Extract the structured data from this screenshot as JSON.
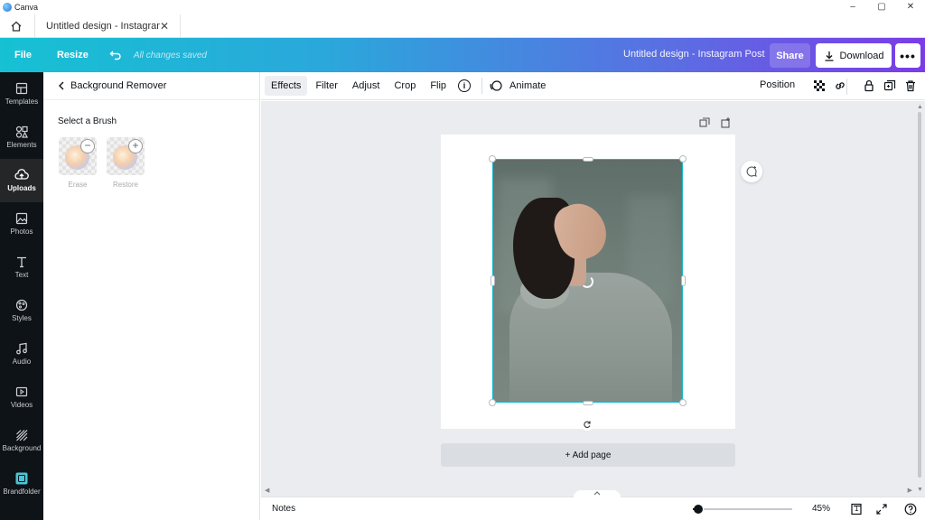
{
  "window": {
    "app_name": "Canva",
    "controls": [
      "–",
      "▢",
      "✕"
    ]
  },
  "tab": {
    "title": "Untitled design - Instagram P",
    "close": "✕"
  },
  "header": {
    "file_label": "File",
    "resize_label": "Resize",
    "saved_status": "All changes saved",
    "design_title": "Untitled design - Instagram Post",
    "share_label": "Share",
    "download_label": "Download",
    "more_label": "•••"
  },
  "rail": {
    "items": [
      {
        "label": "Templates",
        "icon": "templates-icon"
      },
      {
        "label": "Elements",
        "icon": "elements-icon"
      },
      {
        "label": "Uploads",
        "icon": "uploads-icon",
        "active": true
      },
      {
        "label": "Photos",
        "icon": "photos-icon"
      },
      {
        "label": "Text",
        "icon": "text-icon"
      },
      {
        "label": "Styles",
        "icon": "styles-icon"
      },
      {
        "label": "Audio",
        "icon": "audio-icon"
      },
      {
        "label": "Videos",
        "icon": "videos-icon"
      },
      {
        "label": "Background",
        "icon": "background-icon"
      },
      {
        "label": "Brandfolder",
        "icon": "brandfolder-icon"
      }
    ]
  },
  "panel": {
    "title": "Background Remover",
    "section_title": "Select a Brush",
    "brushes": [
      {
        "label": "Erase",
        "badge": "−"
      },
      {
        "label": "Restore",
        "badge": "+"
      }
    ]
  },
  "toolbar": {
    "effects": "Effects",
    "filter": "Filter",
    "adjust": "Adjust",
    "crop": "Crop",
    "flip": "Flip",
    "info": "i",
    "animate": "Animate",
    "position": "Position"
  },
  "canvas": {
    "add_page": "+ Add page"
  },
  "footer": {
    "notes": "Notes",
    "zoom": "45%",
    "page_count": "1",
    "zoom_fraction": 0.05
  },
  "colors": {
    "accent": "#1bb7c9",
    "rail_bg": "#0e1318",
    "workspace_bg": "#ebecf0",
    "header_gradient_start": "#16c1d3",
    "header_gradient_end": "#7a3ce6"
  }
}
